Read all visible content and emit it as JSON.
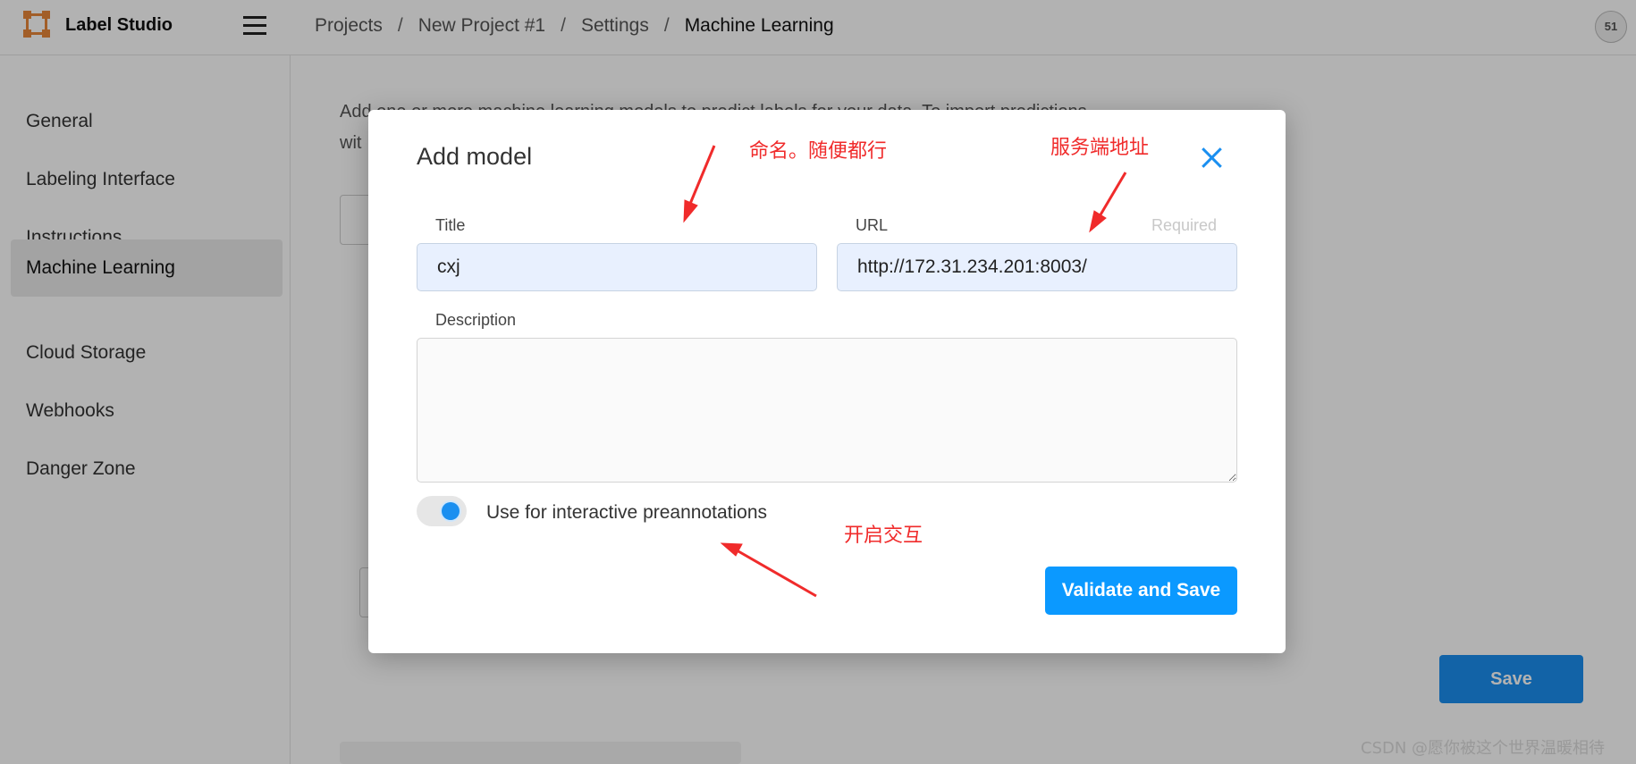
{
  "app": {
    "name": "Label Studio",
    "user_initials": "51"
  },
  "breadcrumb": [
    "Projects",
    "New Project #1",
    "Settings",
    "Machine Learning"
  ],
  "sidebar": {
    "items": [
      {
        "label": "General"
      },
      {
        "label": "Labeling Interface"
      },
      {
        "label": "Instructions"
      },
      {
        "label": "Machine Learning",
        "active": true
      },
      {
        "label": "Cloud Storage"
      },
      {
        "label": "Webhooks"
      },
      {
        "label": "Danger Zone"
      }
    ]
  },
  "main": {
    "intro": "Add one or more machine learning models to predict labels for your data. To import predictions",
    "intro_line2": "wit",
    "save_label": "Save"
  },
  "modal": {
    "title": "Add model",
    "title_label": "Title",
    "title_value": "cxj",
    "url_label": "URL",
    "url_required": "Required",
    "url_value": "http://172.31.234.201:8003/",
    "description_label": "Description",
    "description_value": "",
    "toggle_label": "Use for interactive preannotations",
    "toggle_on": true,
    "submit_label": "Validate and Save"
  },
  "annotations": {
    "title_note": "命名。随便都行",
    "url_note": "服务端地址",
    "toggle_note": "开启交互",
    "color": "#f02b2b"
  },
  "watermark": "CSDN @愿你被这个世界温暖相待",
  "colors": {
    "accent": "#1a8ff0",
    "logo": "#e8873a"
  }
}
